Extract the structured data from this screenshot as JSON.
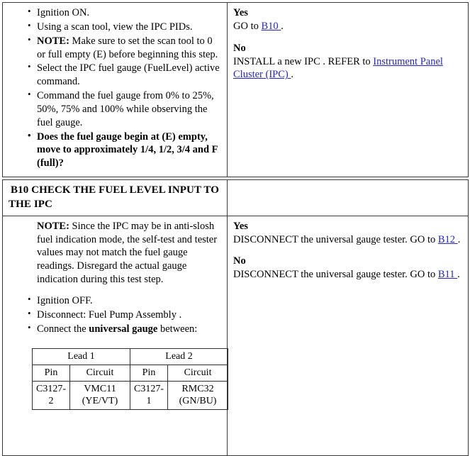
{
  "document": {
    "type": "diagnostic-pinpoint-test-table"
  },
  "sections": [
    {
      "id": "prev-step",
      "left": {
        "bullets": [
          {
            "id": "b1",
            "text": "Ignition ON.",
            "bold": false
          },
          {
            "id": "b2",
            "text": "Using a scan tool, view the IPC PIDs.",
            "bold": false
          },
          {
            "id": "b3",
            "prefix": "NOTE:",
            "text": " Make sure to set the scan tool to 0 or full empty (E) before beginning this step.",
            "bold": false
          },
          {
            "id": "b4",
            "text": "Select the IPC fuel gauge (FuelLevel) active command.",
            "bold": false
          },
          {
            "id": "b5",
            "text": "Command the fuel gauge from 0% to 25%, 50%, 75% and 100% while observing the fuel gauge.",
            "bold": false
          },
          {
            "id": "b6",
            "text": "Does the fuel gauge begin at (E) empty, move to approximately 1/4, 1/2, 3/4 and F (full)?",
            "bold": true
          }
        ]
      },
      "right": {
        "yes_label": "Yes",
        "yes_text_before": "GO to ",
        "yes_link": "B10 ",
        "yes_text_after": ".",
        "no_label": "No",
        "no_text_before": "INSTALL a new IPC . REFER to ",
        "no_link": "Instrument Panel Cluster (IPC) ",
        "no_text_after": "."
      }
    }
  ],
  "b10": {
    "header": {
      "code": "B10",
      "title": "CHECK THE FUEL LEVEL INPUT TO THE IPC"
    },
    "left": {
      "note_prefix": "NOTE:",
      "note_text": " Since the IPC may be in anti-slosh fuel indication mode, the self-test and tester values may not match the fuel gauge readings. Disregard the actual gauge indication during this test step.",
      "bullets": [
        {
          "id": "c1",
          "text": "Ignition OFF."
        },
        {
          "id": "c2",
          "text": "Disconnect: Fuel Pump Assembly ."
        },
        {
          "id": "c3",
          "text_before": "Connect the ",
          "bold_text": "universal gauge",
          "text_after": " between:"
        }
      ],
      "pin_table": {
        "lead_headers": [
          "Lead 1",
          "Lead 2"
        ],
        "sub_headers": [
          "Pin",
          "Circuit",
          "Pin",
          "Circuit"
        ],
        "rows": [
          {
            "lead1_pin": "C3127-2",
            "lead1_circuit_name": "VMC11",
            "lead1_circuit_color": "(YE/VT)",
            "lead2_pin": "C3127-1",
            "lead2_circuit_name": "RMC32",
            "lead2_circuit_color": "(GN/BU)"
          }
        ]
      }
    },
    "right": {
      "yes_label": "Yes",
      "yes_text_before": "DISCONNECT the universal gauge tester. GO to ",
      "yes_link": "B12 ",
      "yes_text_after": ".",
      "no_label": "No",
      "no_text_before": "DISCONNECT the universal gauge tester. GO to ",
      "no_link": "B11 ",
      "no_text_after": "."
    }
  },
  "colors": {
    "link": "#2424cc",
    "border": "#3a3a3a",
    "text": "#000000",
    "background": "#ffffff"
  }
}
